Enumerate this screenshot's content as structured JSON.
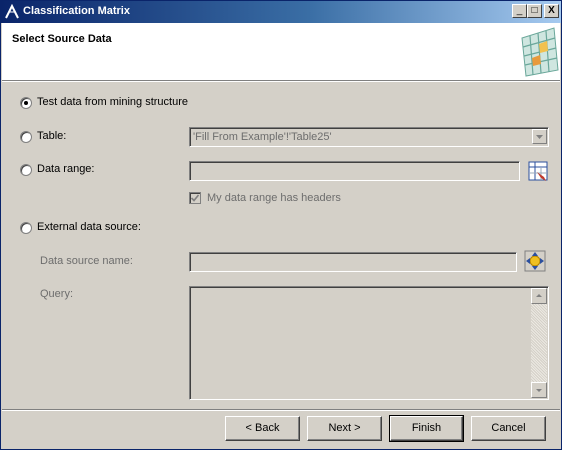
{
  "window": {
    "title": "Classification Matrix",
    "controls": {
      "minimize": "_",
      "maximize": "□",
      "close": "X"
    }
  },
  "header": {
    "title": "Select Source Data",
    "icon": "matrix-grid-icon"
  },
  "options": {
    "test_data": {
      "label": "Test data from mining structure",
      "selected": true
    },
    "table": {
      "label": "Table:",
      "value": "'Fill From Example'!'Table25'",
      "selected": false
    },
    "data_range": {
      "label": "Data range:",
      "value": "",
      "selected": false,
      "headers_checkbox": {
        "label": "My data range has headers",
        "checked": true
      }
    },
    "external": {
      "label": "External data source:",
      "selected": false,
      "data_source_name": {
        "label": "Data source name:",
        "value": ""
      },
      "query": {
        "label": "Query:",
        "value": ""
      }
    }
  },
  "buttons": {
    "back": "< Back",
    "next": "Next >",
    "finish": "Finish",
    "cancel": "Cancel"
  },
  "colors": {
    "titlebar_start": "#0a246a",
    "titlebar_end": "#a6caf0",
    "face": "#d4d0c8"
  }
}
